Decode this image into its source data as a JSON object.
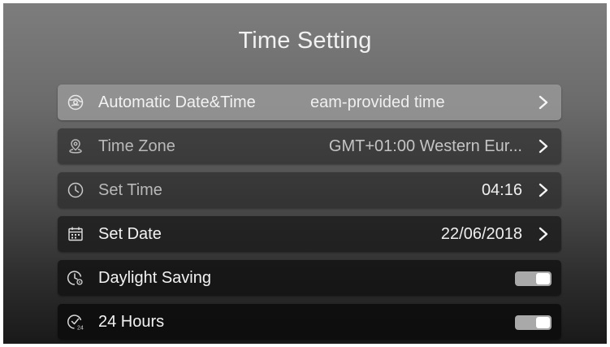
{
  "page": {
    "title": "Time Setting"
  },
  "rows": [
    {
      "label": "Automatic Date&Time",
      "value": "eam-provided time",
      "icon": "globe-clock-icon",
      "control": "chevron",
      "state": "selected"
    },
    {
      "label": "Time Zone",
      "value": "GMT+01:00 Western Eur...",
      "icon": "location-pin-icon",
      "control": "chevron",
      "state": "disabled"
    },
    {
      "label": "Set Time",
      "value": "04:16",
      "icon": "clock-icon",
      "control": "chevron",
      "state": "disabled"
    },
    {
      "label": "Set Date",
      "value": "22/06/2018",
      "icon": "calendar-icon",
      "control": "chevron",
      "state": "normal"
    },
    {
      "label": "Daylight Saving",
      "value": "",
      "icon": "clock-settings-icon",
      "control": "toggle",
      "toggle_on": true
    },
    {
      "label": "24 Hours",
      "value": "",
      "icon": "clock-24-icon",
      "control": "toggle",
      "toggle_on": true
    }
  ],
  "colors": {
    "selected_row": "#a0a0a0",
    "toggle_track": "#a9a9a9",
    "text": "#f2f2f2",
    "dim_text": "#b9b9b9"
  }
}
